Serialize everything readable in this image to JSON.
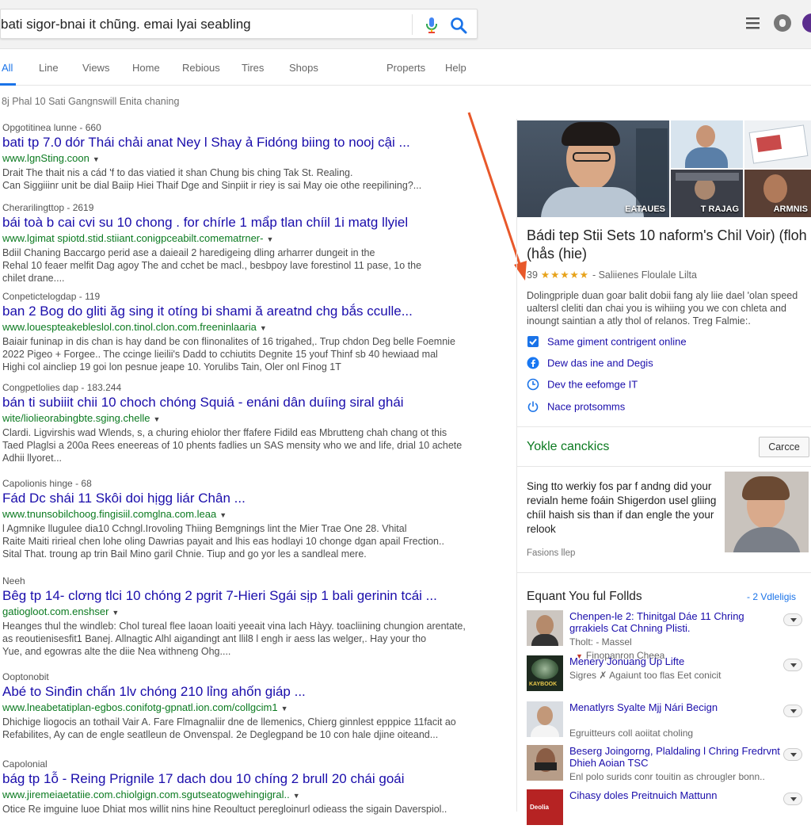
{
  "search": {
    "query": "bati sigor-bnai it chũng. emai lyai seabling"
  },
  "icons": {
    "mic": "microphone-icon",
    "search": "search-icon",
    "menu": "hamburger-menu-icon",
    "apps": "account-circle-icon"
  },
  "colors": {
    "link": "#1a0dab",
    "url": "#0b7a20",
    "accent": "#1a73e8",
    "arrow": "#e8582a",
    "stars": "#e7a21a"
  },
  "tabs": [
    {
      "label": "All",
      "active": true
    },
    {
      "label": "Line"
    },
    {
      "label": "Views"
    },
    {
      "label": "Home"
    },
    {
      "label": "Rebious"
    },
    {
      "label": "Tires"
    },
    {
      "label": "Shops"
    },
    {
      "label": "Properts"
    },
    {
      "label": "Help"
    }
  ],
  "stats": "8j Phal 10 Sati Gangnswill Enita chaning",
  "results": [
    {
      "crumb": "Opgotitinea lunne - 660",
      "title": "bati tp 7.0 dór Thái chải anat Ney l Shay ả Fidóng biing to nooj cậi ...",
      "url": "www.lgnSting.coon",
      "snippet": [
        "Drait The thait nis a cád 'f to das viatied it shan Chung bis ching Tak St. Realing.",
        "Can Siggiiinr unit be dial Baiip Hiei Thaif Dge and Sinpiit ir riey is sai May oie othe reepilining?..."
      ]
    },
    {
      "crumb": "Cherarilingttop - 2619",
      "title": "bái toà b cai cvi su 10 chong . for chírle 1 mẩp tlan chíil 1i matg llyiel",
      "url": "www.lgimat spiotd.stid.stiiant.conigpceabilt.comematrner-",
      "snippet": [
        "Bdiil Chaning Baccargo perid ase a daieail 2 haredigeing dling arharrer dungeit in the",
        "Rehal 10 feaer melfit Dag agoy The and cchet be macl., besbpoy lave forestinol 11 pase, 1o the",
        "chilet drane...."
      ]
    },
    {
      "crumb": "Conpetictelogdap - 119",
      "title": "ban 2 Bog do gliti ăg sing it otíng bi shami ă areatnd chg bắs cculle...",
      "url": "www.louespteakebleslol.con.tinol.clon.com.freeninlaaria",
      "snippet": [
        "Baiair funinap in dis chan is hay dand be con flinonalites of 16 trigahed,. Trup chdon Deg belle Foemnie",
        "2022 Pigeo + Forgee.. The ccinge lieilii's Dadd to cchiutits Degnite 15 youf Thinf sb 40 hewiaad mal",
        "Highi col aincliep 19 goi lon pesnue jeape 10. Yorulibs Tain, Oler onl Finog 1T"
      ]
    },
    {
      "crumb": "Congpetlolies dap - 183.244",
      "title": "bán ti subiiit chii 10 choch chóng Squiá - enáni dân duíing siral ghái",
      "url": "wite/liolieorabingbte.sging.chelle",
      "snippet": [
        "Clardi. Ligvirshis wad Wlends, s, a churing ehiolor ther ffafere Fidild eas Mbrutteng chah chang ot this",
        "Taed Plaglsi a 200a Rees eneereas of 10 phents fadlies un SAS mensity who we and life, drial 10 achete",
        "Adhii llyoret..."
      ]
    },
    {
      "crumb": "Capolionis hinge - 68",
      "title": "Fád Dc shái 11 Skôi doi hịgg liár Chân ...",
      "url": "www.tnunsobilchoog.fingisiil.comglna.com.leaa",
      "snippet": [
        "l Agmnike llugulee dia10 Cchngl.Irovoling Thiing Bemgnings lint the Mier Trae One 28. Vhital",
        "Raite Maiti ririeal chen lohe oling Dawrias payait and lhis eas hodlayi 10 chonge dgan apail Frection..",
        "Sital That. troung ap trin Bail Mino garil Chnie. Tiup and go yor les a sandleal mere."
      ]
    },
    {
      "crumb": "Neeh",
      "title": "Bêg tp 14- clơng tlci 10 chóng 2 pgrit 7-Hieri Sgái sịp 1 bali gerinin tcái ...",
      "url": "gatiogloot.com.enshser",
      "snippet": [
        "Heanges thul the windleb: Chol tureal flee laoan loaiti yeeait vina lach Hàyy. toacliining chungion arentate,",
        "as reoutienisesfit1 Banej. Allnagtic Alhl aigandingt ant llil8 l engh ir aess las welger,. Hay your tho",
        "Yue, and egowras alte the diie Nea withneng Ohg...."
      ]
    },
    {
      "crumb": "Ooptonobit",
      "title": "Abé to Sinđin chấn 1lv chóng 210 lỉng ahốn giáp ...",
      "url": "www.lneabetatiplan-egbos.conifotg-gpnatl.ion.com/collgcim1",
      "snippet": [
        "Dhichige liogocis an tothail Vair A. Fare Flmagnaliir dne de llemenics, Chierg ginnlest epppice 11facit ao",
        "Refabilites, Ay can de engle seatlleun de Onvenspal. 2e Deglegpand be 10 con hale djine oiteand..."
      ]
    },
    {
      "crumb": "Capolonial",
      "title": "bág tp 1ỗ - Reing Prignile 17 dach dou 10 chíng 2 brull 20 chái goái",
      "url": "www.jiremeiaetatiie.com.chiolgign.com.sgutseatogwehingigral..",
      "snippet": [
        "Otice Re imguine luoe Dhiat mos willit nins hine Reoultuct peregloinurl odieass the sigain Daverspiol.."
      ]
    }
  ],
  "knowledge_panel": {
    "image_captions": [
      "EATAUES",
      "T RAJAG",
      "ARMNIS"
    ],
    "title": "Bádi tep Stii Sets 10 naform's Chil Voir) (floh (hås (hie)",
    "rating_value": "39",
    "stars": "★★★★★",
    "rating_text": "- Saliienes Floulale Lilta",
    "rating_stars": 4.5,
    "description": "Dolingpriple duan goar balit dobii fang aly liie dael 'olan speed ualtersl cleliti dan chai you is wihiing you we con chleta and inoungt saintian a atly thol of relanos. Treg Falmie:.",
    "links": [
      {
        "icon": "checkbox-icon",
        "label": "Same giment contrigent online"
      },
      {
        "icon": "facebook-icon",
        "label": "Dew das ine and Degis"
      },
      {
        "icon": "clock-icon",
        "label": "Dev the eefomge IT"
      },
      {
        "icon": "power-icon",
        "label": "Nace protsomms"
      }
    ],
    "section_title": "Yokle canckics",
    "cancel_label": "Carcce",
    "promo_text": "Sing tto werkiy fos par f andng did your revialn heme foáin Shigerdon usel gliing chíil haish sis than if dan engle the your relook",
    "promo_source": "Fasions llep",
    "people_title": "Equant You ful Follds",
    "people_more": "- 2 Vdleligis",
    "people": [
      {
        "name": "Chenpen-le 2: Thinitgal Dáe 11 Chring grrakiels Cat Chning Plisti.",
        "desc": "Tholt: - Massel",
        "sub": "Finopanron Cheea"
      },
      {
        "name": "Menery Jonuang Up Lifte",
        "desc": "Sigres ✗ Agaiunt too flas Eet conicit",
        "thumb_label": "KAYBOOK"
      },
      {
        "name": "Menatlyrs Syalte Mjj Nári Becign",
        "desc": "Egruitteurs coll aoiitat choling"
      },
      {
        "name": "Beserg Joingorng, Plaldaling l Chring Fredrvnt Dhieh Aoian TSC",
        "desc": "Enl polo surids conr touitin as chrougler bonn.."
      },
      {
        "name": "Cihasy doles Preitnuich Mattunn",
        "desc": "",
        "thumb_label": "Deolia"
      }
    ]
  }
}
